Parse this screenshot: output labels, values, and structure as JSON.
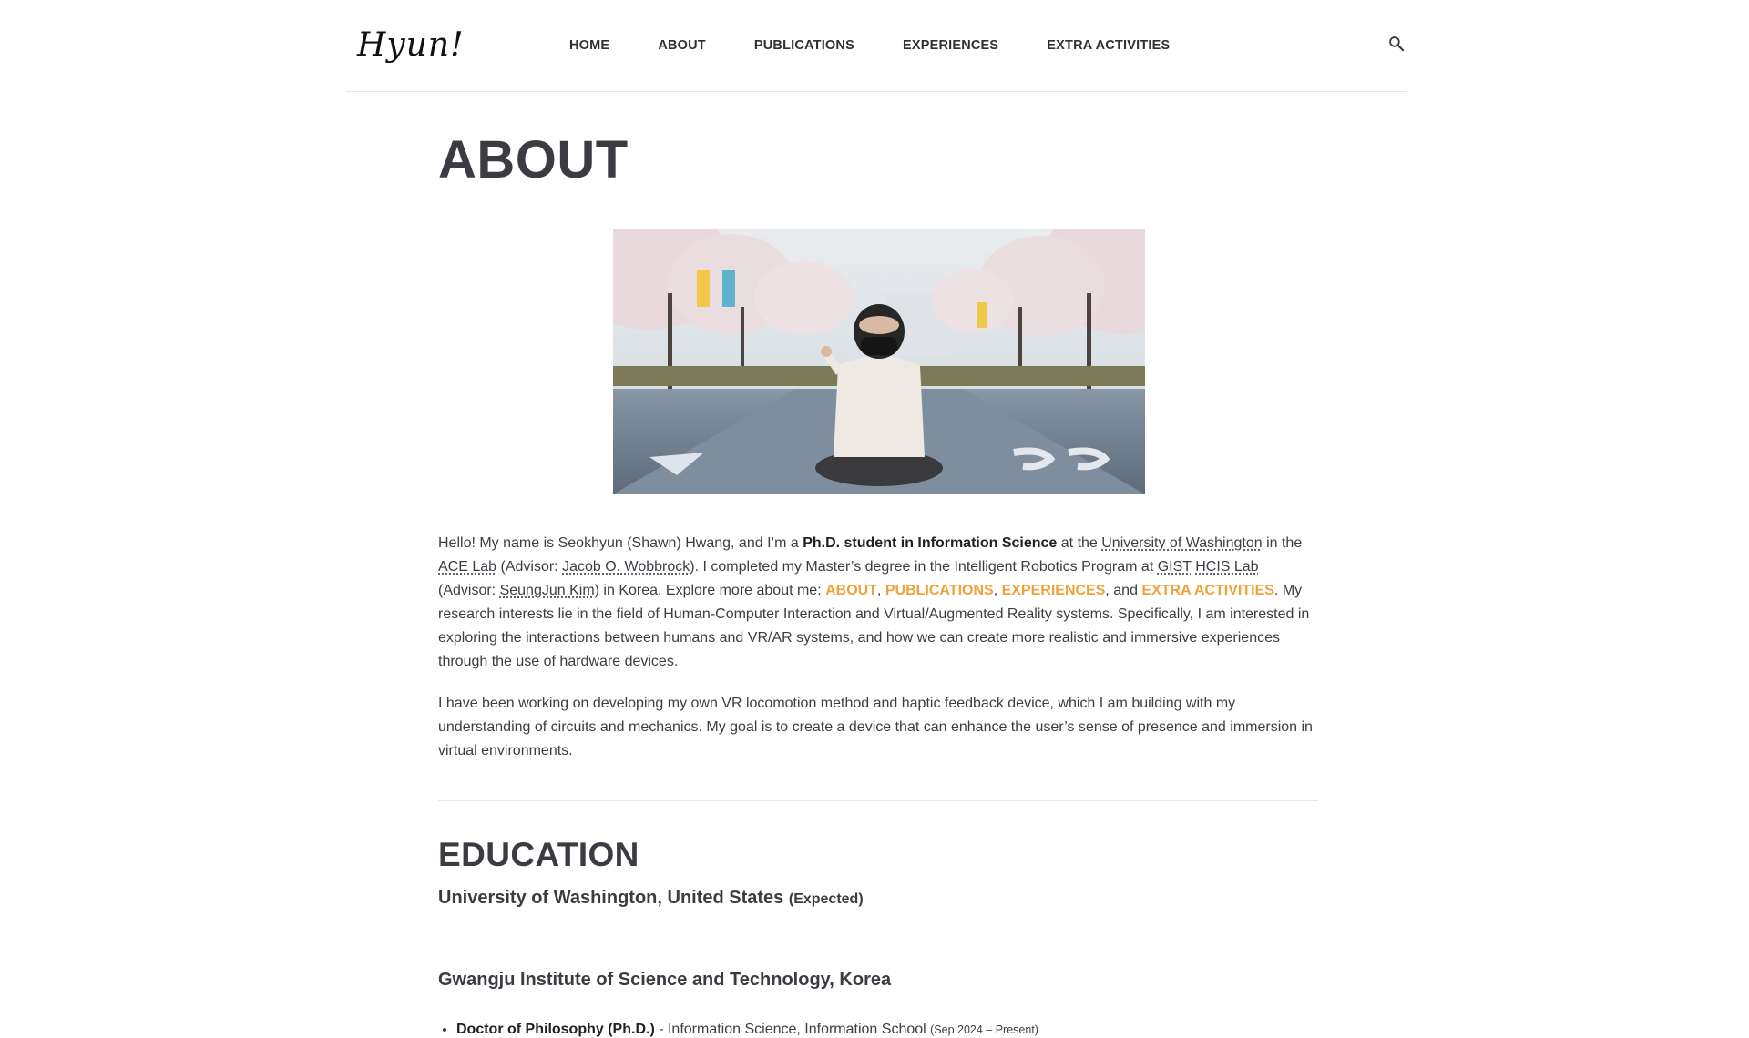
{
  "header": {
    "logo_text": "Hyun!",
    "nav": [
      {
        "label": "HOME"
      },
      {
        "label": "ABOUT"
      },
      {
        "label": "PUBLICATIONS"
      },
      {
        "label": "EXPERIENCES"
      },
      {
        "label": "EXTRA ACTIVITIES"
      }
    ],
    "search_icon": "search-icon"
  },
  "page": {
    "title": "ABOUT"
  },
  "intro": {
    "p1": {
      "t1": "Hello! My name is Seokhyun (Shawn) Hwang, and I’m a ",
      "bold1": "Ph.D. student in Information Science",
      "t2": " at the ",
      "abbr_uw": "University of Washington",
      "t3": " in the ",
      "abbr_ace": "ACE Lab",
      "t4": " (Advisor: ",
      "abbr_jacob": "Jacob O. Wobbrock",
      "t5": "). I completed my Master’s degree in the Intelligent Robotics Program at ",
      "abbr_gist": "GIST",
      "t6": " ",
      "abbr_hcis": "HCIS Lab",
      "t7": " (Advisor: ",
      "abbr_seung": "SeungJun Kim",
      "t8": ") in Korea. Explore more about me: ",
      "link_about": "ABOUT",
      "sep1": ", ",
      "link_pubs": "PUBLICATIONS",
      "sep2": ", ",
      "link_exp": "EXPERIENCES",
      "sep3": ", and ",
      "link_extra": "EXTRA ACTIVITIES",
      "t9": ". My research interests lie in the field of Human-Computer Interaction and Virtual/Augmented Reality systems. Specifically, I am interested in exploring the interactions between humans and VR/AR systems, and how we can create more realistic and immersive experiences through the use of hardware devices."
    },
    "p2": "I have been working on developing my own VR locomotion method and haptic feedback device, which I am building with my understanding of circuits and mechanics. My goal is to create a device that can enhance the user’s sense of presence and immersion in virtual environments."
  },
  "education": {
    "title": "EDUCATION",
    "schools": [
      {
        "name": "University of Washington, United States",
        "note": "(Expected)",
        "degree": "Doctor of Philosophy (Ph.D.)",
        "field": " - Information Science, Information School ",
        "dates": "(Sep 2024 – Present)"
      },
      {
        "name": "Gwangju Institute of Science and Technology, Korea"
      }
    ]
  },
  "colors": {
    "accent": "#f0a23a",
    "text": "#3c3e44",
    "heading": "#3a3c42"
  }
}
